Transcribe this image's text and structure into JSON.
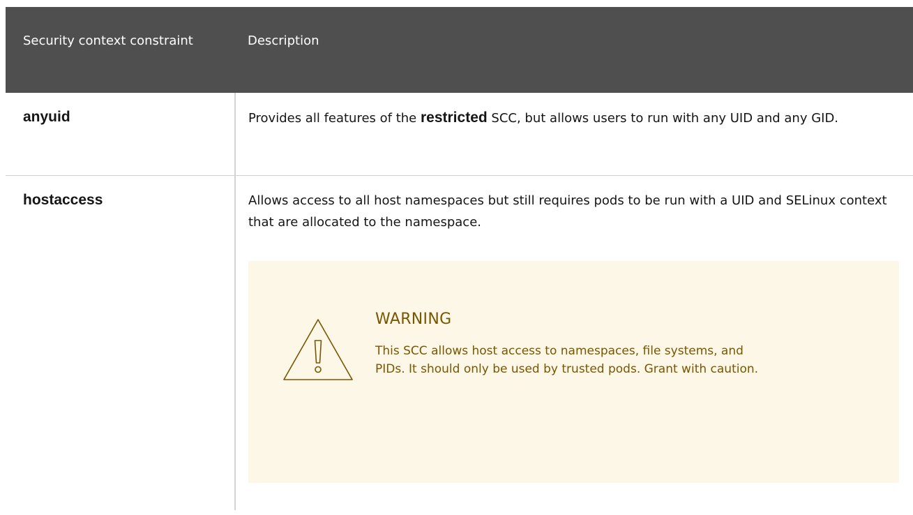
{
  "table": {
    "headers": {
      "constraint": "Security context constraint",
      "description": "Description"
    },
    "rows": [
      {
        "name": "anyuid",
        "desc_before": "Provides all features of the ",
        "desc_strong": "restricted",
        "desc_after": " SCC, but allows users to run with any UID and any GID."
      },
      {
        "name": "hostaccess",
        "desc": "Allows access to all host namespaces but still requires pods to be run with a UID and SELinux context that are allocated to the namespace.",
        "admonition": {
          "icon": "warning-triangle-icon",
          "title": "WARNING",
          "text": "This SCC allows host access to namespaces, file systems, and PIDs. It should only be used by trusted pods. Grant with caution."
        }
      }
    ]
  },
  "colors": {
    "header_bg": "#4f4f4f",
    "warning_bg": "#fdf7e7",
    "warning_text": "#795600",
    "border": "#d2d2d2"
  }
}
